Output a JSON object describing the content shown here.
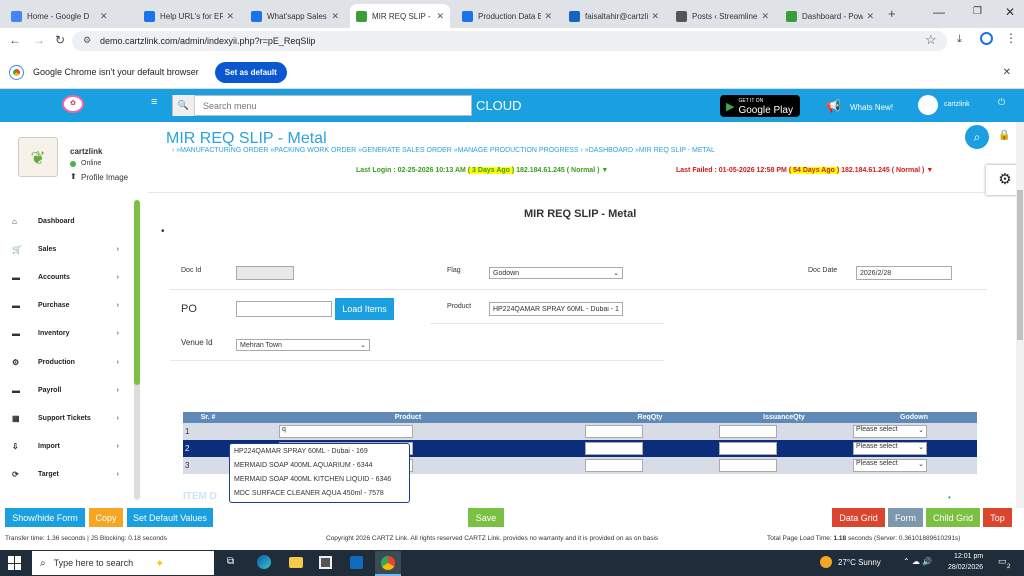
{
  "tabs": [
    {
      "label": "Home - Google D",
      "color": "#4285f4"
    },
    {
      "label": "Help URL's for ERP",
      "color": "#1a73e8"
    },
    {
      "label": "What'sapp Sales M",
      "color": "#1a73e8"
    },
    {
      "label": "MIR REQ SLIP - M",
      "color": "#3a9d3a"
    },
    {
      "label": "Production Data E",
      "color": "#1a73e8"
    },
    {
      "label": "faisaltahir@cartzli",
      "color": "#1565c0"
    },
    {
      "label": "Posts ‹ Streamline",
      "color": "#555"
    },
    {
      "label": "Dashboard - Powe",
      "color": "#3a9d3a"
    }
  ],
  "url": "demo.cartzlink.com/admin/indexyii.php?r=pE_ReqSlip",
  "banner": {
    "text": "Google Chrome isn't your default browser",
    "button": "Set as default"
  },
  "header": {
    "search_placeholder": "Search menu",
    "cloud": "CLOUD",
    "play_small": "GET IT ON",
    "play_big": "Google Play",
    "whats_new": "Whats New!",
    "user": "cartzlink"
  },
  "profile": {
    "name": "cartzlink",
    "status": "Online",
    "profile_image": "Profile Image"
  },
  "sidebar": [
    {
      "label": "Dashboard",
      "icon": "home-icon",
      "glyph": "⌂"
    },
    {
      "label": "Sales",
      "icon": "cart-icon",
      "glyph": "🛒"
    },
    {
      "label": "Accounts",
      "icon": "accounts-icon",
      "glyph": "▬"
    },
    {
      "label": "Purchase",
      "icon": "purchase-icon",
      "glyph": "▬"
    },
    {
      "label": "Inventory",
      "icon": "inventory-icon",
      "glyph": "▬"
    },
    {
      "label": "Production",
      "icon": "production-icon",
      "glyph": "⚙"
    },
    {
      "label": "Payroll",
      "icon": "payroll-icon",
      "glyph": "▬"
    },
    {
      "label": "Support Tickets",
      "icon": "ticket-icon",
      "glyph": "▦"
    },
    {
      "label": "Import",
      "icon": "import-icon",
      "glyph": "⇩"
    },
    {
      "label": "Target",
      "icon": "target-icon",
      "glyph": "⟳"
    }
  ],
  "page": {
    "title": "MIR REQ SLIP - Metal",
    "breadcrumb": "› »MANUFACTURING ORDER »PACKING WORK ORDER »GENERATE SALES ORDER »MANAGE PRODUCTION PROGRESS › »DASHBOARD »MIR REQ SLIP - METAL",
    "last_login_pre": "Last Login : 02-25-2026 10:13 AM ",
    "last_login_hl": "( 3 Days Ago )",
    "last_login_post": " 182.184.61.245 ( Normal ) ▼",
    "last_failed_pre": "Last Failed : 01-05-2026 12:58 PM ",
    "last_failed_hl": "( 54 Days Ago )",
    "last_failed_post": " 182.184.61.245 ( Normal ) ▼",
    "form_title": "MIR REQ SLIP - Metal"
  },
  "form": {
    "doc_id_label": "Doc Id",
    "doc_id_value": "",
    "flag_label": "Flag",
    "flag_value": "Godown",
    "doc_date_label": "Doc Date",
    "doc_date_value": "2026/2/28",
    "po_label": "PO",
    "po_value": "",
    "load_items": "Load Items",
    "product_label": "Product",
    "product_value": "HP224QAMAR SPRAY 60ML - Dubai - 1",
    "venue_label": "Venue Id",
    "venue_value": "Mehran Town"
  },
  "grid": {
    "headers": [
      "Sr. #",
      "Product",
      "ReqQty",
      "IssuanceQty",
      "Godown"
    ],
    "rows": [
      {
        "sr": "1",
        "product": "q"
      },
      {
        "sr": "2",
        "product": ""
      },
      {
        "sr": "3",
        "product": ""
      }
    ],
    "godown_placeholder": "Please select"
  },
  "autocomplete": [
    "HP224QAMAR SPRAY 60ML - Dubai - 169",
    "MERMAID SOAP 400ML AQUARIUM - 6344",
    "MERMAID SOAP 400ML KITCHEN LIQUID - 6346",
    "MDC SURFACE CLEANER AQUA 450ml - 7578"
  ],
  "bottom_buttons": {
    "show_hide": "Show/hide Form",
    "copy": "Copy",
    "set_default": "Set Default Values",
    "save": "Save",
    "data_grid": "Data Grid",
    "form": "Form",
    "child_grid": "Child Grid",
    "top": "Top"
  },
  "status": {
    "left": "Transfer time: 1.36 seconds | JS Blocking: 0.18 seconds",
    "center": "Copyright 2026 CARTZ Link. All rights reserved CARTZ Link. provides no warranty and it is provided on as on basis",
    "right_pre": "Total Page Load Time: ",
    "right_bold": "1.18",
    "right_post": " seconds (Server: 0.36101889610291s)"
  },
  "taskbar": {
    "search": "Type here to search",
    "weather": "27°C  Sunny",
    "time": "12:01 pm",
    "date": "28/02/2026",
    "notif": "2"
  }
}
